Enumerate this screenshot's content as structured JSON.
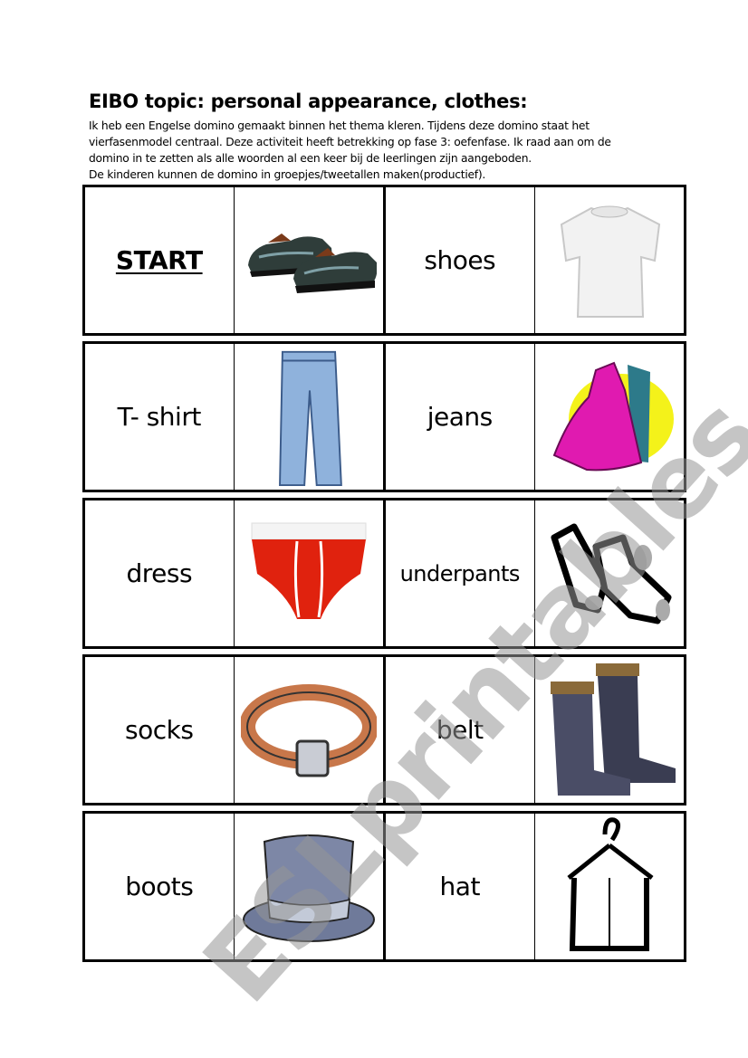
{
  "header": {
    "title": "EIBO topic: personal appearance, clothes:",
    "intro_lines": [
      "Ik heb een Engelse domino gemaakt binnen het thema kleren. Tijdens deze domino staat het",
      "vierfasenmodel centraal. Deze activiteit heeft betrekking op fase 3: oefenfase. Ik raad aan om de",
      "domino in te zetten als alle woorden al een keer bij de leerlingen zijn aangeboden.",
      "De kinderen kunnen de domino in groepjes/tweetallen maken(productief)."
    ]
  },
  "dominoes": [
    {
      "left": {
        "word": "START",
        "picture": "shoes-icon"
      },
      "right": {
        "word": "shoes",
        "picture": "tshirt-icon"
      }
    },
    {
      "left": {
        "word": "T- shirt",
        "picture": "jeans-icon"
      },
      "right": {
        "word": "jeans",
        "picture": "dress-icon"
      }
    },
    {
      "left": {
        "word": "dress",
        "picture": "underpants-icon"
      },
      "right": {
        "word": "underpants",
        "picture": "socks-icon"
      }
    },
    {
      "left": {
        "word": "socks",
        "picture": "belt-icon"
      },
      "right": {
        "word": "belt",
        "picture": "boots-icon"
      }
    },
    {
      "left": {
        "word": "boots",
        "picture": "hat-icon"
      },
      "right": {
        "word": "hat",
        "picture": "coat-on-hanger-icon"
      }
    }
  ],
  "watermark": "ESLprintables.com"
}
